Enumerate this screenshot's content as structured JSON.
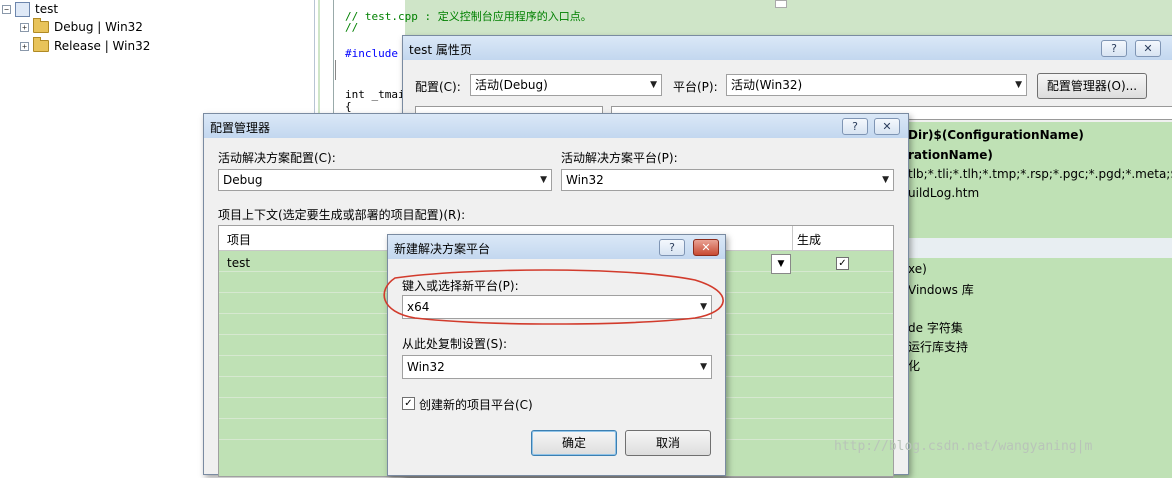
{
  "solution_tree": {
    "root": "test",
    "items": [
      {
        "expander": "+",
        "label": "Debug | Win32"
      },
      {
        "expander": "+",
        "label": "Release | Win32"
      }
    ]
  },
  "code": {
    "line1": "// test.cpp : 定义控制台应用程序的入口点。",
    "line2": "//",
    "line3": "#include",
    "line4": "int _tmai",
    "line5": "{"
  },
  "property_pages": {
    "title": "test 属性页",
    "help": "?",
    "close": "✕",
    "config_label": "配置(C):",
    "config_value": "活动(Debug)",
    "platform_label": "平台(P):",
    "platform_value": "活动(Win32)",
    "config_manager_button": "配置管理器(O)...",
    "props": [
      "Dir)$(ConfigurationName)",
      "rationName)",
      "tlb;*.tli;*.tlh;*.tmp;*.rsp;*.pgc;*.pgd;*.meta;$",
      "uildLog.htm",
      "xe)",
      "Vindows 库",
      "de 字符集",
      "运行库支持",
      "化"
    ]
  },
  "config_manager": {
    "title": "配置管理器",
    "help": "?",
    "close": "✕",
    "solution_config_label": "活动解决方案配置(C):",
    "solution_config_value": "Debug",
    "solution_platform_label": "活动解决方案平台(P):",
    "solution_platform_value": "Win32",
    "context_label": "项目上下文(选定要生成或部署的项目配置)(R):",
    "columns": [
      "项目",
      "生成"
    ],
    "rows": [
      {
        "project": "test",
        "build": true
      }
    ]
  },
  "new_platform_dialog": {
    "title": "新建解决方案平台",
    "help": "?",
    "close": "✕",
    "new_platform_label": "键入或选择新平台(P):",
    "new_platform_value": "x64",
    "copy_from_label": "从此处复制设置(S):",
    "copy_from_value": "Win32",
    "create_project_platforms_label": "创建新的项目平台(C)",
    "create_project_platforms_checked": true,
    "ok_button": "确定",
    "cancel_button": "取消"
  },
  "watermark": "http://blog.csdn.net/wangyaning|m"
}
